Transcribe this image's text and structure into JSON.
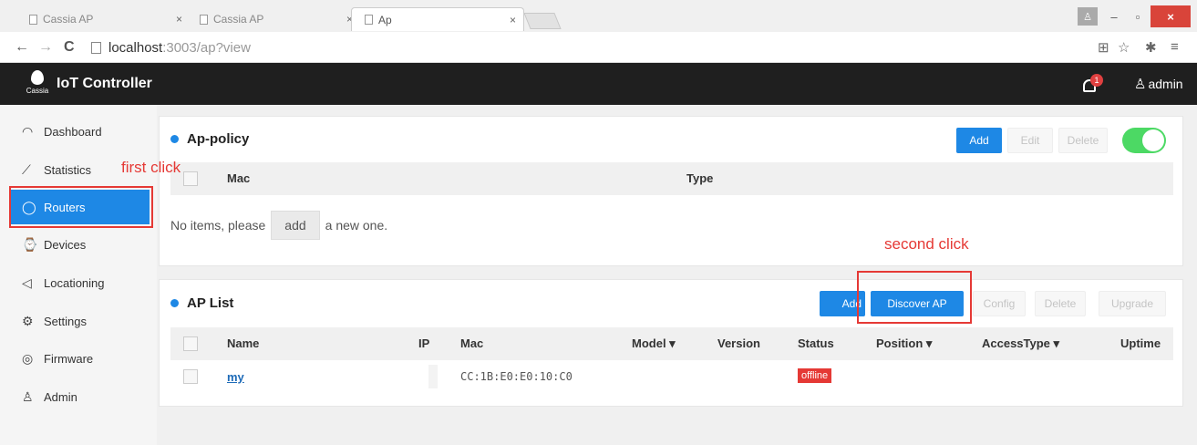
{
  "browser": {
    "tabs": [
      {
        "label": "Cassia AP",
        "close": "×"
      },
      {
        "label": "Cassia AP",
        "close": "×"
      },
      {
        "label": "Ap",
        "close": "×"
      }
    ],
    "window_controls": {
      "minimize": "–",
      "maximize": "▫",
      "close": "×"
    },
    "address": {
      "host": "localhost",
      "path": ":3003/ap?view"
    },
    "nav": {
      "back": "←",
      "forward": "→",
      "reload": "C"
    },
    "icons": {
      "translate": "⊞",
      "star": "☆",
      "extension": "✱",
      "menu": "≡"
    }
  },
  "app": {
    "title": "IoT Controller",
    "logo_label": "Cassia",
    "notifications_count": "1",
    "user": "admin"
  },
  "sidebar": {
    "items": [
      {
        "label": "Dashboard",
        "icon": "◠"
      },
      {
        "label": "Statistics",
        "icon": "⟋"
      },
      {
        "label": "Routers",
        "icon": "◯"
      },
      {
        "label": "Devices",
        "icon": "⌚"
      },
      {
        "label": "Locationing",
        "icon": "◁"
      },
      {
        "label": "Settings",
        "icon": "⚙"
      },
      {
        "label": "Firmware",
        "icon": "◎"
      },
      {
        "label": "Admin",
        "icon": "♙"
      }
    ],
    "active": "Routers"
  },
  "annotations": {
    "first": "first click",
    "second": "second click"
  },
  "ap_policy": {
    "title": "Ap-policy",
    "buttons": {
      "add": "Add",
      "edit": "Edit",
      "delete": "Delete"
    },
    "toggle_on": true,
    "columns": [
      "Mac",
      "Type"
    ],
    "empty": {
      "before": "No items, please",
      "action": "add",
      "after": "a new one."
    }
  },
  "ap_list": {
    "title": "AP List",
    "buttons": {
      "add": "Add",
      "discover": "Discover AP",
      "config": "Config",
      "delete": "Delete",
      "upgrade": "Upgrade"
    },
    "columns": [
      "Name",
      "IP",
      "Mac",
      "Model ▾",
      "Version",
      "Status",
      "Position ▾",
      "AccessType ▾",
      "Uptime"
    ],
    "rows": [
      {
        "name": "my",
        "ip": "",
        "mac": "CC:1B:E0:E0:10:C0",
        "model": "",
        "version": "",
        "status": "offline",
        "position": "",
        "access_type": "",
        "uptime": ""
      }
    ]
  },
  "colors": {
    "accent": "#1e88e5",
    "annotation": "#e53935",
    "toggle": "#4cd964",
    "header": "#1f1f1f"
  }
}
